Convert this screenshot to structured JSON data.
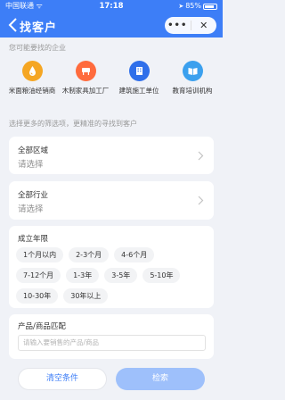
{
  "status_bar": {
    "carrier": "中国联通 ᯤ",
    "time": "17:18",
    "battery_text": "85%",
    "battery_level": 0.85
  },
  "nav": {
    "title": "找客户",
    "more": "•••",
    "close": "✕"
  },
  "hint_likely": "您可能要找的企业",
  "shortcuts": [
    {
      "label": "米面粮油经销商",
      "icon": "oil-drop-icon",
      "color": "#f5a623"
    },
    {
      "label": "木制家具加工厂",
      "icon": "furniture-icon",
      "color": "#ff6b3d"
    },
    {
      "label": "建筑施工单位",
      "icon": "building-icon",
      "color": "#2f6fea"
    },
    {
      "label": "教育培训机构",
      "icon": "book-icon",
      "color": "#3ba0ee"
    }
  ],
  "hint_filters": "选择更多的筛选项，更精准的寻找到客户",
  "region": {
    "title": "全部区域",
    "value": "请选择"
  },
  "industry": {
    "title": "全部行业",
    "value": "请选择"
  },
  "founded": {
    "title": "成立年限",
    "rows": [
      [
        "1个月以内",
        "2-3个月",
        "4-6个月"
      ],
      [
        "7-12个月",
        "1-3年",
        "3-5年",
        "5-10年"
      ],
      [
        "10-30年",
        "30年以上"
      ]
    ]
  },
  "product": {
    "title": "产品/商品匹配",
    "placeholder": "请输入要销售的产品/商品"
  },
  "buttons": {
    "clear": "清空条件",
    "search": "检索"
  },
  "colors": {
    "primary": "#3d7ef7",
    "search_disabled": "#9ec0fb",
    "background": "#f0f2f7"
  }
}
